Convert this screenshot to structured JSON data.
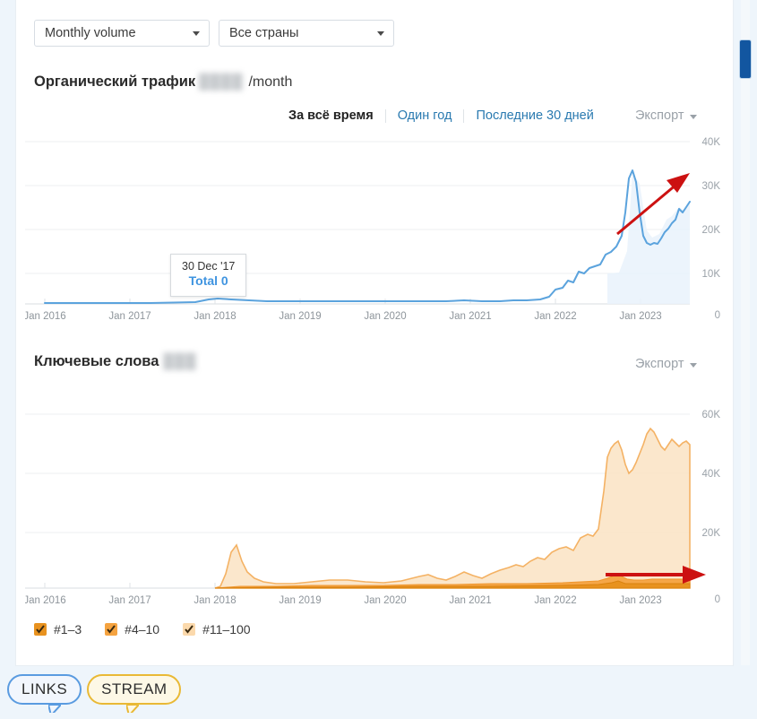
{
  "controls": {
    "volume_select": {
      "value": "Monthly volume",
      "icon": "chevron-down-icon"
    },
    "country_select": {
      "value": "Все страны",
      "icon": "chevron-down-icon"
    }
  },
  "traffic_section": {
    "title": "Органический трафик",
    "blurred_value": "████",
    "suffix": "/month",
    "tabs": [
      {
        "label": "За всё время",
        "active": true
      },
      {
        "label": "Один год",
        "active": false
      },
      {
        "label": "Последние 30 дней",
        "active": false
      }
    ],
    "export_label": "Экспорт",
    "export_icon": "chevron-down-icon",
    "tooltip": {
      "date": "30 Dec '17",
      "total_label": "Total 0"
    }
  },
  "keywords_section": {
    "title": "Ключевые слова",
    "blurred_value": "███",
    "export_label": "Экспорт",
    "export_icon": "chevron-down-icon",
    "legend": [
      {
        "label": "#1–3",
        "color": "#e8921f",
        "checked": true
      },
      {
        "label": "#4–10",
        "color": "#f5a340",
        "checked": true
      },
      {
        "label": "#11–100",
        "color": "#fbd9ac",
        "checked": true
      }
    ]
  },
  "badges": [
    {
      "label": "LINKS",
      "border": "#5a9be0",
      "bg": "#f2f6fd"
    },
    {
      "label": "STREAM",
      "border": "#e9b935",
      "bg": "#fdf8e6"
    }
  ],
  "chart_data": [
    {
      "type": "line",
      "title": "Органический трафик",
      "xlabel": "",
      "ylabel": "",
      "ylim": [
        0,
        40000
      ],
      "yticks": [
        0,
        10000,
        20000,
        30000,
        40000
      ],
      "ytick_labels": [
        "0",
        "10K",
        "20K",
        "30K",
        "40K"
      ],
      "xticks": [
        "Jan 2016",
        "Jan 2017",
        "Jan 2018",
        "Jan 2019",
        "Jan 2020",
        "Jan 2021",
        "Jan 2022",
        "Jan 2023"
      ],
      "grid": true,
      "legend_position": "none",
      "line_color": "#5ba3dd",
      "fill_color": "#eaf3fb",
      "annotation": {
        "type": "arrow",
        "color": "#cc1111",
        "direction": "up-right"
      },
      "series": [
        {
          "name": "Organic traffic",
          "x": [
            "2016-01",
            "2016-07",
            "2017-01",
            "2017-07",
            "2018-01",
            "2018-04",
            "2018-07",
            "2018-10",
            "2019-01",
            "2019-07",
            "2020-01",
            "2020-07",
            "2021-01",
            "2021-04",
            "2021-07",
            "2021-10",
            "2022-01",
            "2022-03",
            "2022-05",
            "2022-06",
            "2022-07",
            "2022-08",
            "2022-09",
            "2022-10",
            "2022-11",
            "2022-12",
            "2023-01",
            "2023-03"
          ],
          "values": [
            0,
            0,
            0,
            0,
            200,
            900,
            700,
            600,
            500,
            500,
            400,
            400,
            400,
            350,
            300,
            900,
            4000,
            7000,
            9500,
            31000,
            16000,
            14500,
            15000,
            18500,
            20000,
            21000,
            22500,
            23000
          ]
        }
      ]
    },
    {
      "type": "area",
      "title": "Ключевые слова",
      "xlabel": "",
      "ylabel": "",
      "ylim": [
        0,
        65000
      ],
      "yticks": [
        0,
        20000,
        40000,
        60000
      ],
      "ytick_labels": [
        "0",
        "20K",
        "40K",
        "60K"
      ],
      "xticks": [
        "Jan 2016",
        "Jan 2017",
        "Jan 2018",
        "Jan 2019",
        "Jan 2020",
        "Jan 2021",
        "Jan 2022",
        "Jan 2023"
      ],
      "grid": true,
      "stacked": true,
      "legend_position": "bottom",
      "annotation": {
        "type": "arrow",
        "color": "#cc1111",
        "direction": "right"
      },
      "series": [
        {
          "name": "#1–3",
          "color": "#e8921f",
          "x": [
            "2018-01",
            "2018-04",
            "2019-01",
            "2020-01",
            "2021-01",
            "2022-01",
            "2022-06",
            "2022-09",
            "2023-01",
            "2023-03"
          ],
          "values": [
            0,
            200,
            150,
            200,
            300,
            600,
            2600,
            1400,
            1800,
            1800
          ]
        },
        {
          "name": "#4–10",
          "color": "#f5a340",
          "x": [
            "2018-01",
            "2018-04",
            "2019-01",
            "2020-01",
            "2021-01",
            "2022-01",
            "2022-06",
            "2022-09",
            "2023-01",
            "2023-03"
          ],
          "values": [
            0,
            400,
            300,
            400,
            700,
            1400,
            3200,
            2600,
            2800,
            2800
          ]
        },
        {
          "name": "#11–100",
          "color": "#fbd9ac",
          "x": [
            "2018-01",
            "2018-03",
            "2018-05",
            "2018-08",
            "2019-01",
            "2019-06",
            "2020-01",
            "2020-06",
            "2021-01",
            "2021-04",
            "2021-07",
            "2021-10",
            "2022-01",
            "2022-03",
            "2022-05",
            "2022-06",
            "2022-07",
            "2022-09",
            "2022-11",
            "2023-01",
            "2023-02",
            "2023-03"
          ],
          "values": [
            0,
            9000,
            5000,
            1500,
            1800,
            2000,
            2200,
            4000,
            9000,
            7000,
            9000,
            13000,
            16000,
            19000,
            50000,
            54000,
            44000,
            49000,
            56000,
            51000,
            49000,
            53000
          ]
        }
      ]
    }
  ]
}
